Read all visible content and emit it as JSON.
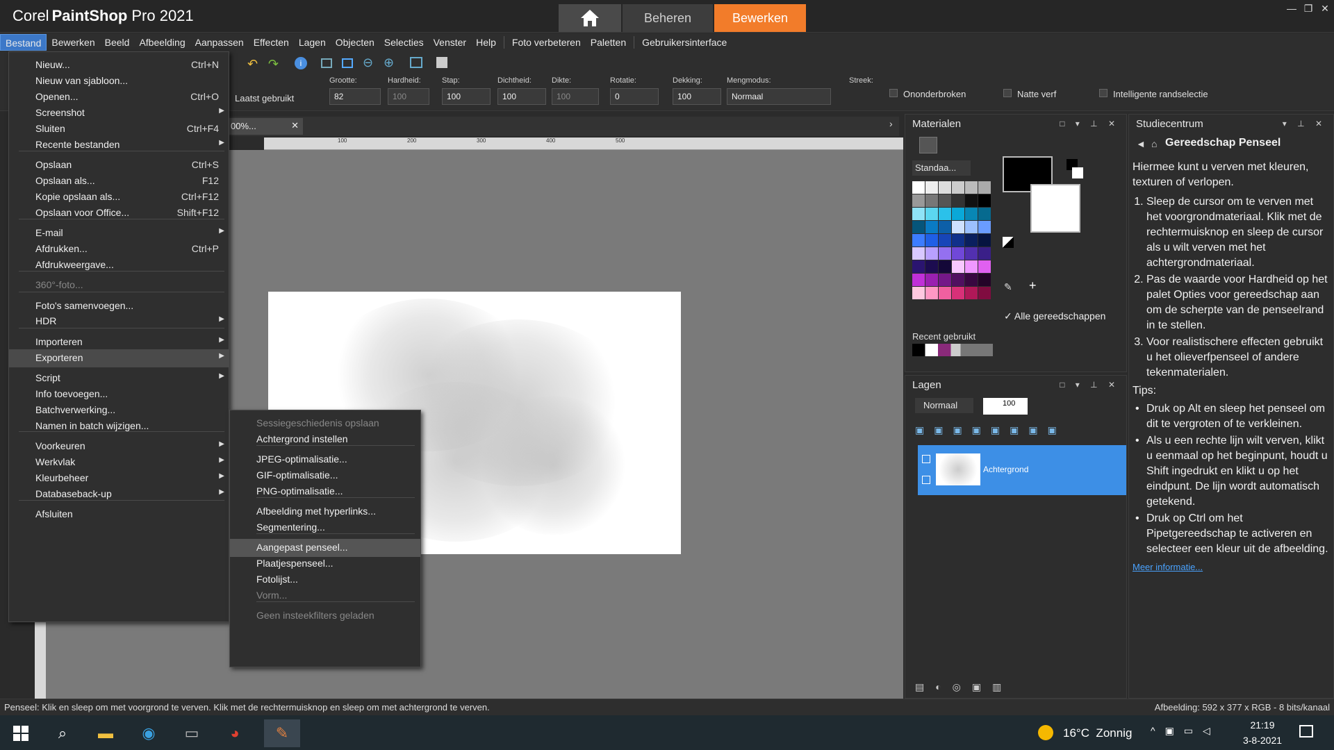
{
  "app": {
    "brand": "Corel",
    "product": "PaintShop",
    "product_suffix": "Pro 2021",
    "tabs": {
      "manage": "Beheren",
      "edit": "Bewerken"
    }
  },
  "menubar": [
    "Bestand",
    "Bewerken",
    "Beeld",
    "Afbeelding",
    "Aanpassen",
    "Effecten",
    "Lagen",
    "Objecten",
    "Selecties",
    "Venster",
    "Help",
    "Foto verbeteren",
    "Paletten",
    "Gebruikersinterface"
  ],
  "options": {
    "preset": "Laatst gebruikt",
    "grootte_label": "Grootte:",
    "grootte": "82",
    "hardheid_label": "Hardheid:",
    "hardheid": "100",
    "stap_label": "Stap:",
    "stap": "100",
    "dichtheid_label": "Dichtheid:",
    "dichtheid": "100",
    "dikte_label": "Dikte:",
    "dikte": "100",
    "rotatie_label": "Rotatie:",
    "rotatie": "0",
    "dekking_label": "Dekking:",
    "dekking": "100",
    "mengmodus_label": "Mengmodus:",
    "mengmodus": "Normaal",
    "streek_label": "Streek:",
    "onderbroken": "Ononderbroken",
    "natte_verf": "Natte verf",
    "randselectie": "Intelligente randselectie"
  },
  "document": {
    "tab_label": "00%...",
    "ruler_ticks": [
      "100",
      "200",
      "300",
      "400",
      "500"
    ]
  },
  "file_menu": {
    "items": [
      {
        "label": "Nieuw...",
        "shortcut": "Ctrl+N"
      },
      {
        "label": "Nieuw van sjabloon...",
        "shortcut": ""
      },
      {
        "label": "Openen...",
        "shortcut": "Ctrl+O"
      },
      {
        "label": "Screenshot",
        "shortcut": ""
      },
      {
        "label": "Sluiten",
        "shortcut": "Ctrl+F4"
      },
      {
        "label": "Recente bestanden",
        "shortcut": ""
      },
      {
        "label": "Opslaan",
        "shortcut": "Ctrl+S"
      },
      {
        "label": "Opslaan als...",
        "shortcut": "F12"
      },
      {
        "label": "Kopie opslaan als...",
        "shortcut": "Ctrl+F12"
      },
      {
        "label": "Opslaan voor Office...",
        "shortcut": "Shift+F12"
      },
      {
        "label": "E-mail",
        "shortcut": ""
      },
      {
        "label": "Afdrukken...",
        "shortcut": "Ctrl+P"
      },
      {
        "label": "Afdrukweergave...",
        "shortcut": ""
      },
      {
        "label": "360°-foto...",
        "shortcut": ""
      },
      {
        "label": "Foto's samenvoegen...",
        "shortcut": ""
      },
      {
        "label": "HDR",
        "shortcut": ""
      },
      {
        "label": "Importeren",
        "shortcut": ""
      },
      {
        "label": "Exporteren",
        "shortcut": ""
      },
      {
        "label": "Script",
        "shortcut": ""
      },
      {
        "label": "Info toevoegen...",
        "shortcut": ""
      },
      {
        "label": "Batchverwerking...",
        "shortcut": ""
      },
      {
        "label": "Namen in batch wijzigen...",
        "shortcut": ""
      },
      {
        "label": "Voorkeuren",
        "shortcut": ""
      },
      {
        "label": "Werkvlak",
        "shortcut": ""
      },
      {
        "label": "Kleurbeheer",
        "shortcut": ""
      },
      {
        "label": "Databaseback-up",
        "shortcut": ""
      },
      {
        "label": "Afsluiten",
        "shortcut": ""
      }
    ]
  },
  "export_submenu": [
    "Sessiegeschiedenis opslaan",
    "Achtergrond instellen",
    "JPEG-optimalisatie...",
    "GIF-optimalisatie...",
    "PNG-optimalisatie...",
    "Afbeelding met hyperlinks...",
    "Segmentering...",
    "Aangepast penseel...",
    "Plaatjespenseel...",
    "Fotolijst...",
    "Vorm...",
    "Geen insteekfilters geladen"
  ],
  "materials": {
    "title": "Materialen",
    "palette_select": "Standaa...",
    "all_tools": "Alle gereedschappen",
    "recent": "Recent gebruikt"
  },
  "layers": {
    "title": "Lagen",
    "blend": "Normaal",
    "opacity": "100",
    "layer_name": "Achtergrond"
  },
  "study": {
    "title": "Studiecentrum",
    "heading": "Gereedschap Penseel",
    "intro": "Hiermee kunt u verven met kleuren, texturen of verlopen.",
    "steps": [
      "Sleep de cursor om te verven met het voorgrondmateriaal. Klik met de rechtermuisknop en sleep de cursor als u wilt verven met het achtergrondmateriaal.",
      "Pas de waarde voor Hardheid op het palet Opties voor gereedschap aan om de scherpte van de penseelrand in te stellen.",
      "Voor realistischere effecten gebruikt u het olieverfpenseel of andere tekenmaterialen."
    ],
    "tips_label": "Tips:",
    "tips": [
      "Druk op Alt en sleep het penseel om dit te vergroten of te verkleinen.",
      "Als u een rechte lijn wilt verven, klikt u eenmaal op het beginpunt, houdt u Shift ingedrukt en klikt u op het eindpunt. De lijn wordt automatisch getekend.",
      "Druk op Ctrl om het Pipetgereedschap te activeren en selecteer een kleur uit de afbeelding."
    ],
    "more": "Meer informatie..."
  },
  "status": {
    "left": "Penseel: Klik en sleep om met voorgrond te verven. Klik met de rechtermuisknop en sleep om met achtergrond te verven.",
    "right": "Afbeelding:  592 x 377 x RGB - 8 bits/kanaal"
  },
  "taskbar": {
    "weather": "16°C  Zonnig",
    "time": "21:19",
    "date": "3-8-2021"
  },
  "colors": {
    "accent_orange": "#f27c2a",
    "selection_blue": "#3d8fe6"
  }
}
